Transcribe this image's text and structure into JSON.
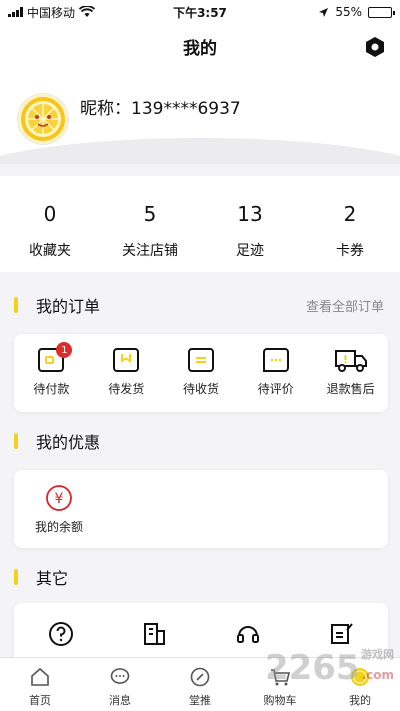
{
  "status_bar": {
    "carrier": "中国移动",
    "time": "下午3:57",
    "battery": "55%",
    "battery_level": 0.55
  },
  "header": {
    "title": "我的"
  },
  "profile": {
    "nickname": "昵称：139****6937"
  },
  "stats": [
    {
      "value": "0",
      "label": "收藏夹"
    },
    {
      "value": "5",
      "label": "关注店铺"
    },
    {
      "value": "13",
      "label": "足迹"
    },
    {
      "value": "2",
      "label": "卡券"
    }
  ],
  "orders": {
    "title": "我的订单",
    "view_all": "查看全部订单",
    "items": [
      {
        "label": "待付款",
        "badge": "1"
      },
      {
        "label": "待发货"
      },
      {
        "label": "待收货"
      },
      {
        "label": "待评价"
      },
      {
        "label": "退款售后"
      }
    ]
  },
  "coupons": {
    "title": "我的优惠",
    "balance_label": "我的余额",
    "yen_symbol": "¥"
  },
  "others": {
    "title": "其它"
  },
  "tabs": [
    {
      "label": "首页"
    },
    {
      "label": "消息"
    },
    {
      "label": "堂推"
    },
    {
      "label": "购物车"
    },
    {
      "label": "我的"
    }
  ],
  "watermark": {
    "text": "2265",
    "suffix": ".com",
    "site": "游戏网"
  },
  "accent_color": "#f3d21a"
}
